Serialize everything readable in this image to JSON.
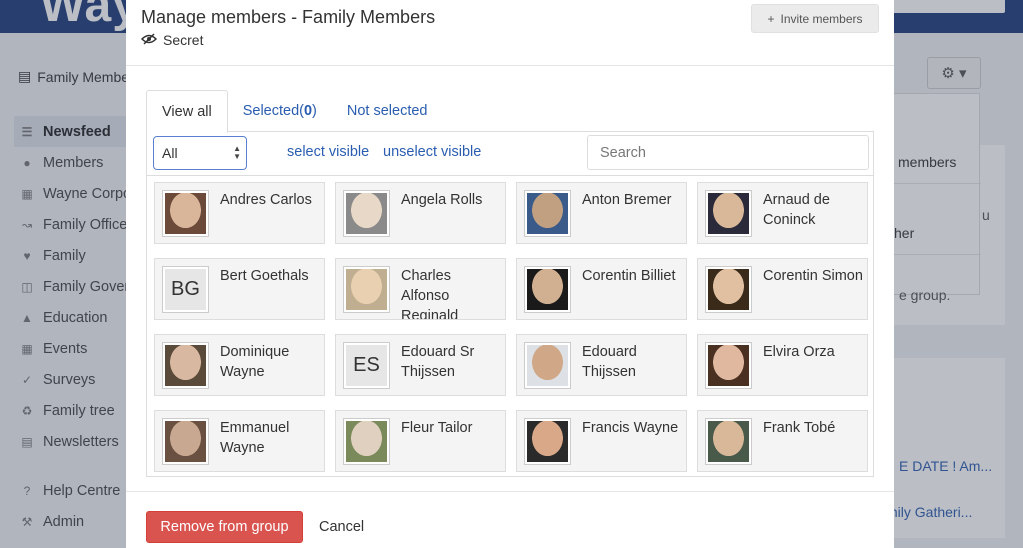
{
  "background": {
    "logo": "Way",
    "group_title": "Family Membe",
    "nav": [
      {
        "label": "Newsfeed",
        "icon": "list-icon",
        "active": true
      },
      {
        "label": "Members",
        "icon": "users-icon"
      },
      {
        "label": "Wayne Corpo",
        "icon": "building-icon"
      },
      {
        "label": "Family Office",
        "icon": "chart-icon"
      },
      {
        "label": "Family",
        "icon": "heart-icon"
      },
      {
        "label": "Family Gover",
        "icon": "database-icon"
      },
      {
        "label": "Education",
        "icon": "graduation-icon"
      },
      {
        "label": "Events",
        "icon": "calendar-icon"
      },
      {
        "label": "Surveys",
        "icon": "check-icon"
      },
      {
        "label": "Family tree",
        "icon": "tree-icon"
      },
      {
        "label": "Newsletters",
        "icon": "newspaper-icon"
      }
    ],
    "nav_bottom": [
      {
        "label": "Help Centre",
        "icon": "help-icon"
      },
      {
        "label": "Admin",
        "icon": "tools-icon"
      }
    ],
    "dropdown_text_1": "members",
    "dropdown_text_2": "her",
    "right_text_1": "e group.",
    "right_text_2": "u",
    "link_1": "E DATE ! Am...",
    "link_2": "mily Gatheri..."
  },
  "modal": {
    "title": "Manage members - Family Members",
    "privacy": "Secret",
    "invite_label": "Invite members",
    "tabs": {
      "view_all": "View all",
      "selected_label": "Selected(",
      "selected_count": "0",
      "selected_close": ")",
      "not_selected": "Not selected"
    },
    "filter_value": "All",
    "select_visible": "select visible",
    "unselect_visible": "unselect visible",
    "search_placeholder": "Search",
    "members": [
      {
        "name": "Andres Carlos",
        "photo": true
      },
      {
        "name": "Angela Rolls",
        "photo": true
      },
      {
        "name": "Anton Bremer",
        "photo": true
      },
      {
        "name": "Arnaud de Coninck",
        "photo": true
      },
      {
        "name": "Bert Goethals",
        "initials": "BG"
      },
      {
        "name": "Charles Alfonso Reginald",
        "photo": true
      },
      {
        "name": "Corentin Billiet",
        "photo": true
      },
      {
        "name": "Corentin Simon",
        "photo": true
      },
      {
        "name": "Dominique Wayne",
        "photo": true
      },
      {
        "name": "Edouard Sr Thijssen",
        "initials": "ES"
      },
      {
        "name": "Edouard Thijssen",
        "photo": true
      },
      {
        "name": "Elvira Orza",
        "photo": true
      },
      {
        "name": "Emmanuel Wayne",
        "photo": true
      },
      {
        "name": "Fleur Tailor",
        "photo": true
      },
      {
        "name": "Francis Wayne",
        "photo": true
      },
      {
        "name": "Frank Tobé",
        "photo": true
      }
    ],
    "remove_label": "Remove from group",
    "cancel_label": "Cancel"
  }
}
